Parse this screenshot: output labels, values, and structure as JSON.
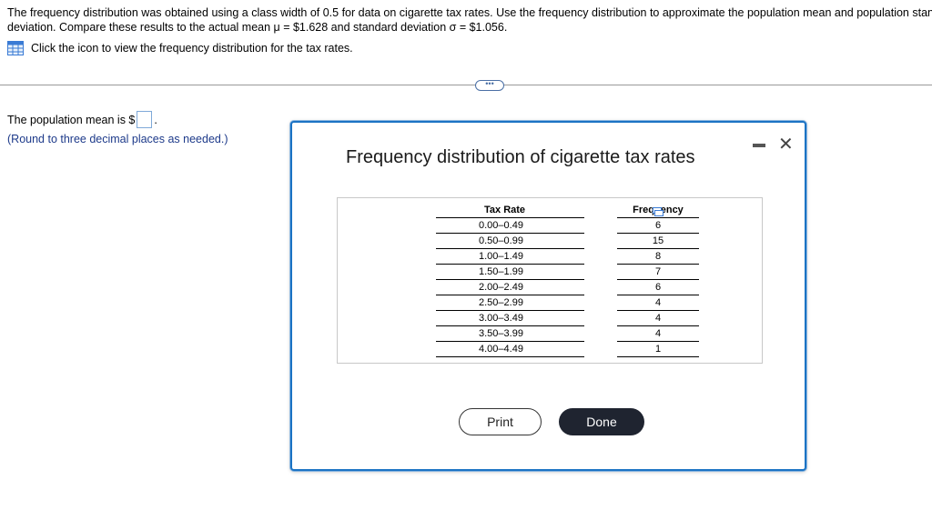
{
  "question": {
    "line1": "The frequency distribution was obtained using a class width of 0.5 for data on cigarette tax rates. Use the frequency distribution to approximate the population mean and population standard",
    "line2": "deviation. Compare these results to the actual mean μ = $1.628 and standard deviation σ = $1.056.",
    "icon_instruction": "Click the icon to view the frequency distribution for the tax rates."
  },
  "expander_label": "•••",
  "answer": {
    "prompt": "The population mean is $",
    "suffix": ".",
    "value": "",
    "hint": "(Round to three decimal places as needed.)"
  },
  "dialog": {
    "title": "Frequency distribution of cigarette tax rates",
    "minimize_label": "",
    "close_label": "✕",
    "table": {
      "headers": [
        "Tax Rate",
        "Frequency"
      ],
      "rows": [
        [
          "0.00–0.49",
          "6"
        ],
        [
          "0.50–0.99",
          "15"
        ],
        [
          "1.00–1.49",
          "8"
        ],
        [
          "1.50–1.99",
          "7"
        ],
        [
          "2.00–2.49",
          "6"
        ],
        [
          "2.50–2.99",
          "4"
        ],
        [
          "3.00–3.49",
          "4"
        ],
        [
          "3.50–3.99",
          "4"
        ],
        [
          "4.00–4.49",
          "1"
        ]
      ]
    },
    "print_label": "Print",
    "done_label": "Done"
  },
  "icons": {
    "data_table": "grid-table-icon",
    "copy": "copy-icon",
    "close": "close-icon",
    "minimize": "minimize-icon"
  },
  "colors": {
    "accent": "#1b73c4",
    "hint": "#1d3a8a",
    "done_button": "#1f2430"
  }
}
